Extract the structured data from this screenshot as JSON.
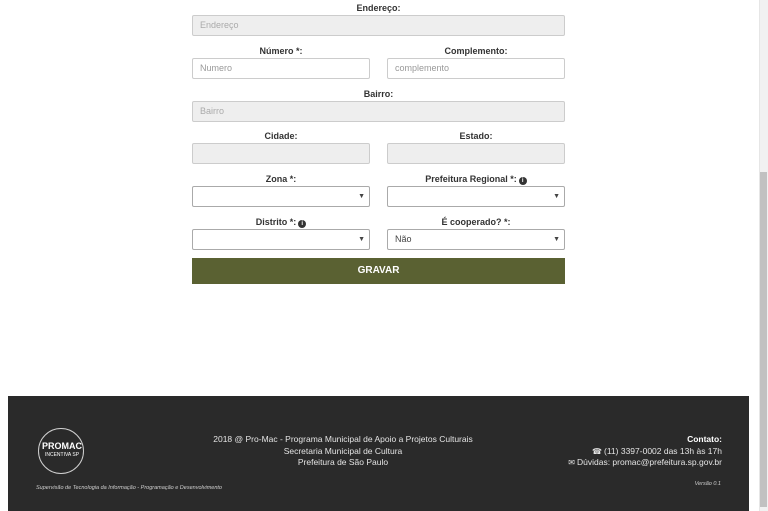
{
  "form": {
    "endereco_label": "Endereço:",
    "endereco_placeholder": "Endereço",
    "numero_label": "Número *:",
    "numero_placeholder": "Numero",
    "complemento_label": "Complemento:",
    "complemento_placeholder": "complemento",
    "bairro_label": "Bairro:",
    "bairro_placeholder": "Bairro",
    "cidade_label": "Cidade:",
    "estado_label": "Estado:",
    "zona_label": "Zona *:",
    "zona_value": "",
    "prefeitura_label": "Prefeitura Regional *:",
    "prefeitura_value": "",
    "distrito_label": "Distrito *:",
    "distrito_value": "",
    "cooperado_label": "É cooperado? *:",
    "cooperado_value": "Não",
    "submit_label": "GRAVAR"
  },
  "icons": {
    "info": "info-icon",
    "phone": "phone-icon",
    "envelope": "envelope-icon",
    "caret": "caret-down-icon"
  },
  "footer": {
    "logo_main": "PROMAC",
    "logo_sub": "INCENTIVA SP",
    "line1": "2018 @ Pro-Mac - Programa Municipal de Apoio a Projetos Culturais",
    "line2": "Secretaria Municipal de Cultura",
    "line3": "Prefeitura de São Paulo",
    "contact_title": "Contato:",
    "phone": "(11) 3397-0002 das 13h às 17h",
    "email": "Dúvidas: promac@prefeitura.sp.gov.br",
    "credit": "Supervisão de Tecnologia da Informação - Programação e Desenvolvimento",
    "version": "Versão 0.1"
  },
  "colors": {
    "button": "#5a6132",
    "footer_bg": "#2a2a2a"
  }
}
